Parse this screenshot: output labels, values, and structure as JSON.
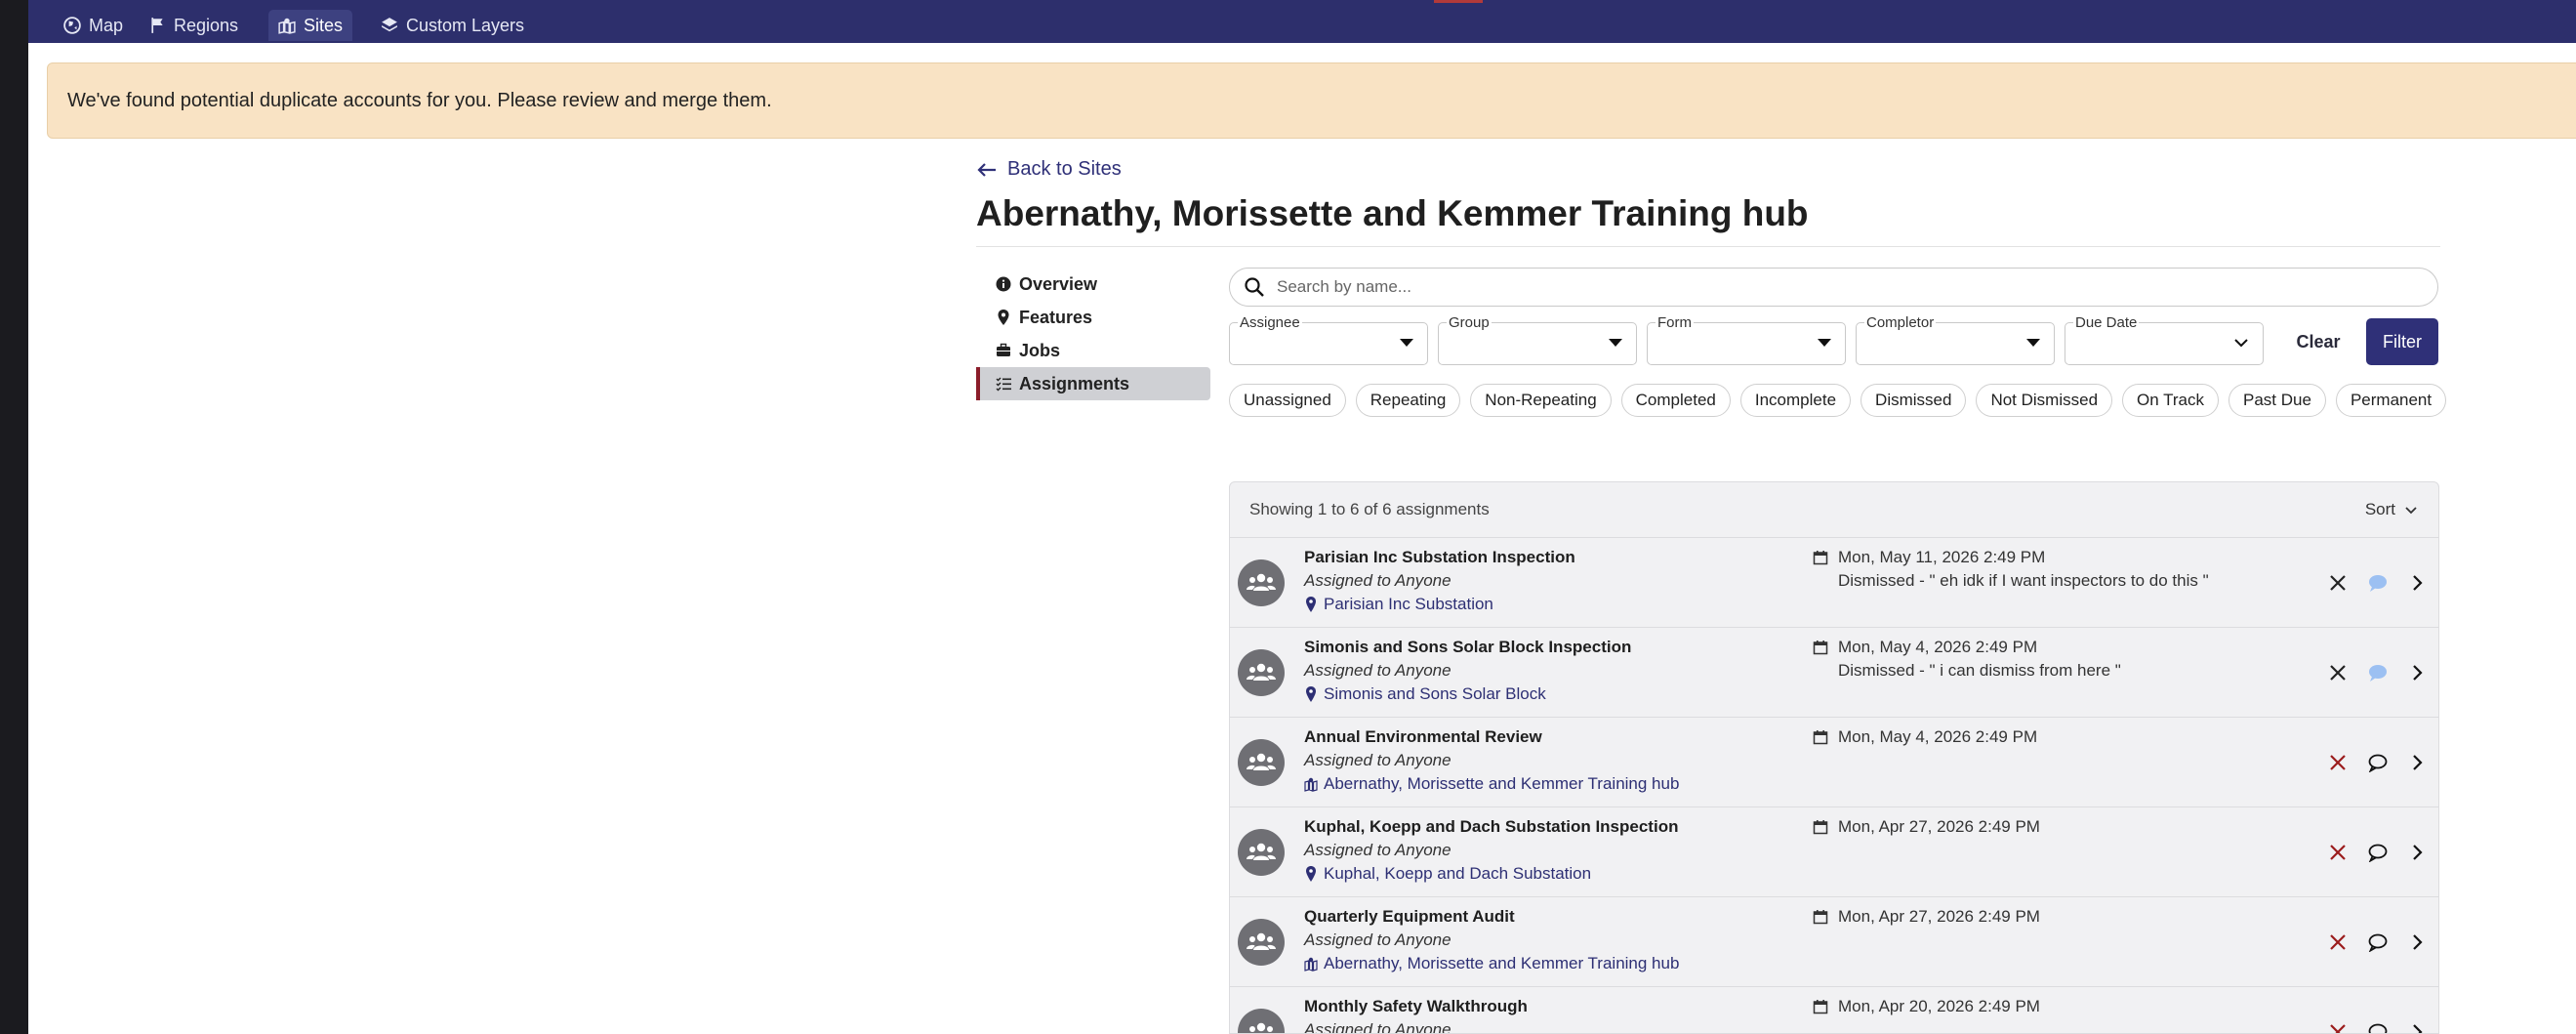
{
  "nav": {
    "items": [
      {
        "label": "Map",
        "icon": "globe-icon",
        "active": false
      },
      {
        "label": "Regions",
        "icon": "flag-icon",
        "active": false
      },
      {
        "label": "Sites",
        "icon": "map-pin-building-icon",
        "active": true
      },
      {
        "label": "Custom Layers",
        "icon": "layers-icon",
        "active": false
      }
    ],
    "bg_color": "#2d2f6c"
  },
  "alert": {
    "text": "We've found potential duplicate accounts for you. Please review and merge them.",
    "bg_color": "#f9e3c4"
  },
  "back_link": "Back to Sites",
  "page_title": "Abernathy, Morissette and Kemmer Training hub",
  "side_menu": [
    {
      "label": "Overview",
      "icon": "info-icon"
    },
    {
      "label": "Features",
      "icon": "map-pin-icon"
    },
    {
      "label": "Jobs",
      "icon": "briefcase-icon"
    },
    {
      "label": "Assignments",
      "icon": "list-check-icon",
      "active": true
    }
  ],
  "search": {
    "placeholder": "Search by name..."
  },
  "filters": [
    {
      "label": "Assignee",
      "value": ""
    },
    {
      "label": "Group",
      "value": ""
    },
    {
      "label": "Form",
      "value": ""
    },
    {
      "label": "Completor",
      "value": ""
    },
    {
      "label": "Due Date",
      "value": ""
    }
  ],
  "buttons": {
    "clear": "Clear",
    "filter": "Filter"
  },
  "accent_color": "#2f3078",
  "chips": [
    "Unassigned",
    "Repeating",
    "Non-Repeating",
    "Completed",
    "Incomplete",
    "Dismissed",
    "Not Dismissed",
    "On Track",
    "Past Due",
    "Permanent"
  ],
  "list": {
    "summary": "Showing 1 to 6 of 6 assignments",
    "sort_label": "Sort",
    "rows": [
      {
        "title": "Parisian Inc Substation Inspection",
        "assigned": "Assigned to Anyone",
        "location": "Parisian Inc Substation",
        "location_icon": "map-pin-icon",
        "date": "Mon, May 11, 2026 2:49 PM",
        "dismissed": "Dismissed - \" eh idk if I want inspectors to do this \"",
        "dismiss_icon_color": "#222222",
        "comment_icon": "comment-filled-icon"
      },
      {
        "title": "Simonis and Sons Solar Block Inspection",
        "assigned": "Assigned to Anyone",
        "location": "Simonis and Sons Solar Block",
        "location_icon": "map-pin-icon",
        "date": "Mon, May 4, 2026 2:49 PM",
        "dismissed": "Dismissed - \" i can dismiss from here \"",
        "dismiss_icon_color": "#222222",
        "comment_icon": "comment-filled-icon"
      },
      {
        "title": "Annual Environmental Review",
        "assigned": "Assigned to Anyone",
        "location": "Abernathy, Morissette and Kemmer Training hub",
        "location_icon": "site-icon",
        "date": "Mon, May 4, 2026 2:49 PM",
        "dismissed": "",
        "dismiss_icon_color": "#9b1c1c",
        "comment_icon": "comment-outline-icon"
      },
      {
        "title": "Kuphal, Koepp and Dach Substation Inspection",
        "assigned": "Assigned to Anyone",
        "location": "Kuphal, Koepp and Dach Substation",
        "location_icon": "map-pin-icon",
        "date": "Mon, Apr 27, 2026 2:49 PM",
        "dismissed": "",
        "dismiss_icon_color": "#9b1c1c",
        "comment_icon": "comment-outline-icon"
      },
      {
        "title": "Quarterly Equipment Audit",
        "assigned": "Assigned to Anyone",
        "location": "Abernathy, Morissette and Kemmer Training hub",
        "location_icon": "site-icon",
        "date": "Mon, Apr 27, 2026 2:49 PM",
        "dismissed": "",
        "dismiss_icon_color": "#9b1c1c",
        "comment_icon": "comment-outline-icon"
      },
      {
        "title": "Monthly Safety Walkthrough",
        "assigned": "Assigned to Anyone",
        "location": "",
        "location_icon": "map-pin-icon",
        "date": "Mon, Apr 20, 2026 2:49 PM",
        "dismissed": "",
        "dismiss_icon_color": "#9b1c1c",
        "comment_icon": "comment-outline-icon"
      }
    ]
  }
}
